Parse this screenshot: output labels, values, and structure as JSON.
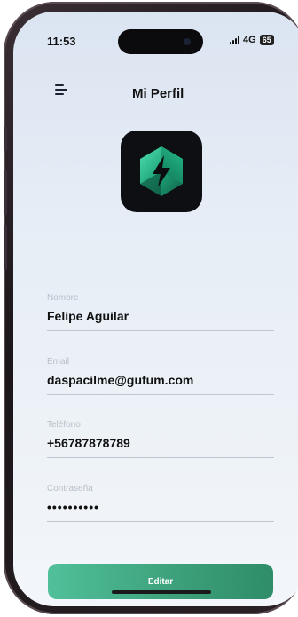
{
  "status_bar": {
    "time": "11:53",
    "network": "4G",
    "battery": "65"
  },
  "header": {
    "title": "Mi Perfil",
    "menu_icon": "hamburger-menu-icon"
  },
  "logo": {
    "icon": "lightning-bolt-hexagon-icon",
    "accent": "#1fa57a"
  },
  "form": {
    "name_label": "Nombre",
    "name_value": "Felipe Aguilar",
    "email_label": "Email",
    "email_value": "daspacilme@gufum.com",
    "phone_label": "Teléfono",
    "phone_value": "+56787878789",
    "password_label": "Contraseña",
    "password_value": "••••••••••"
  },
  "actions": {
    "edit_label": "Editar",
    "button_color": "#3b9f79"
  }
}
